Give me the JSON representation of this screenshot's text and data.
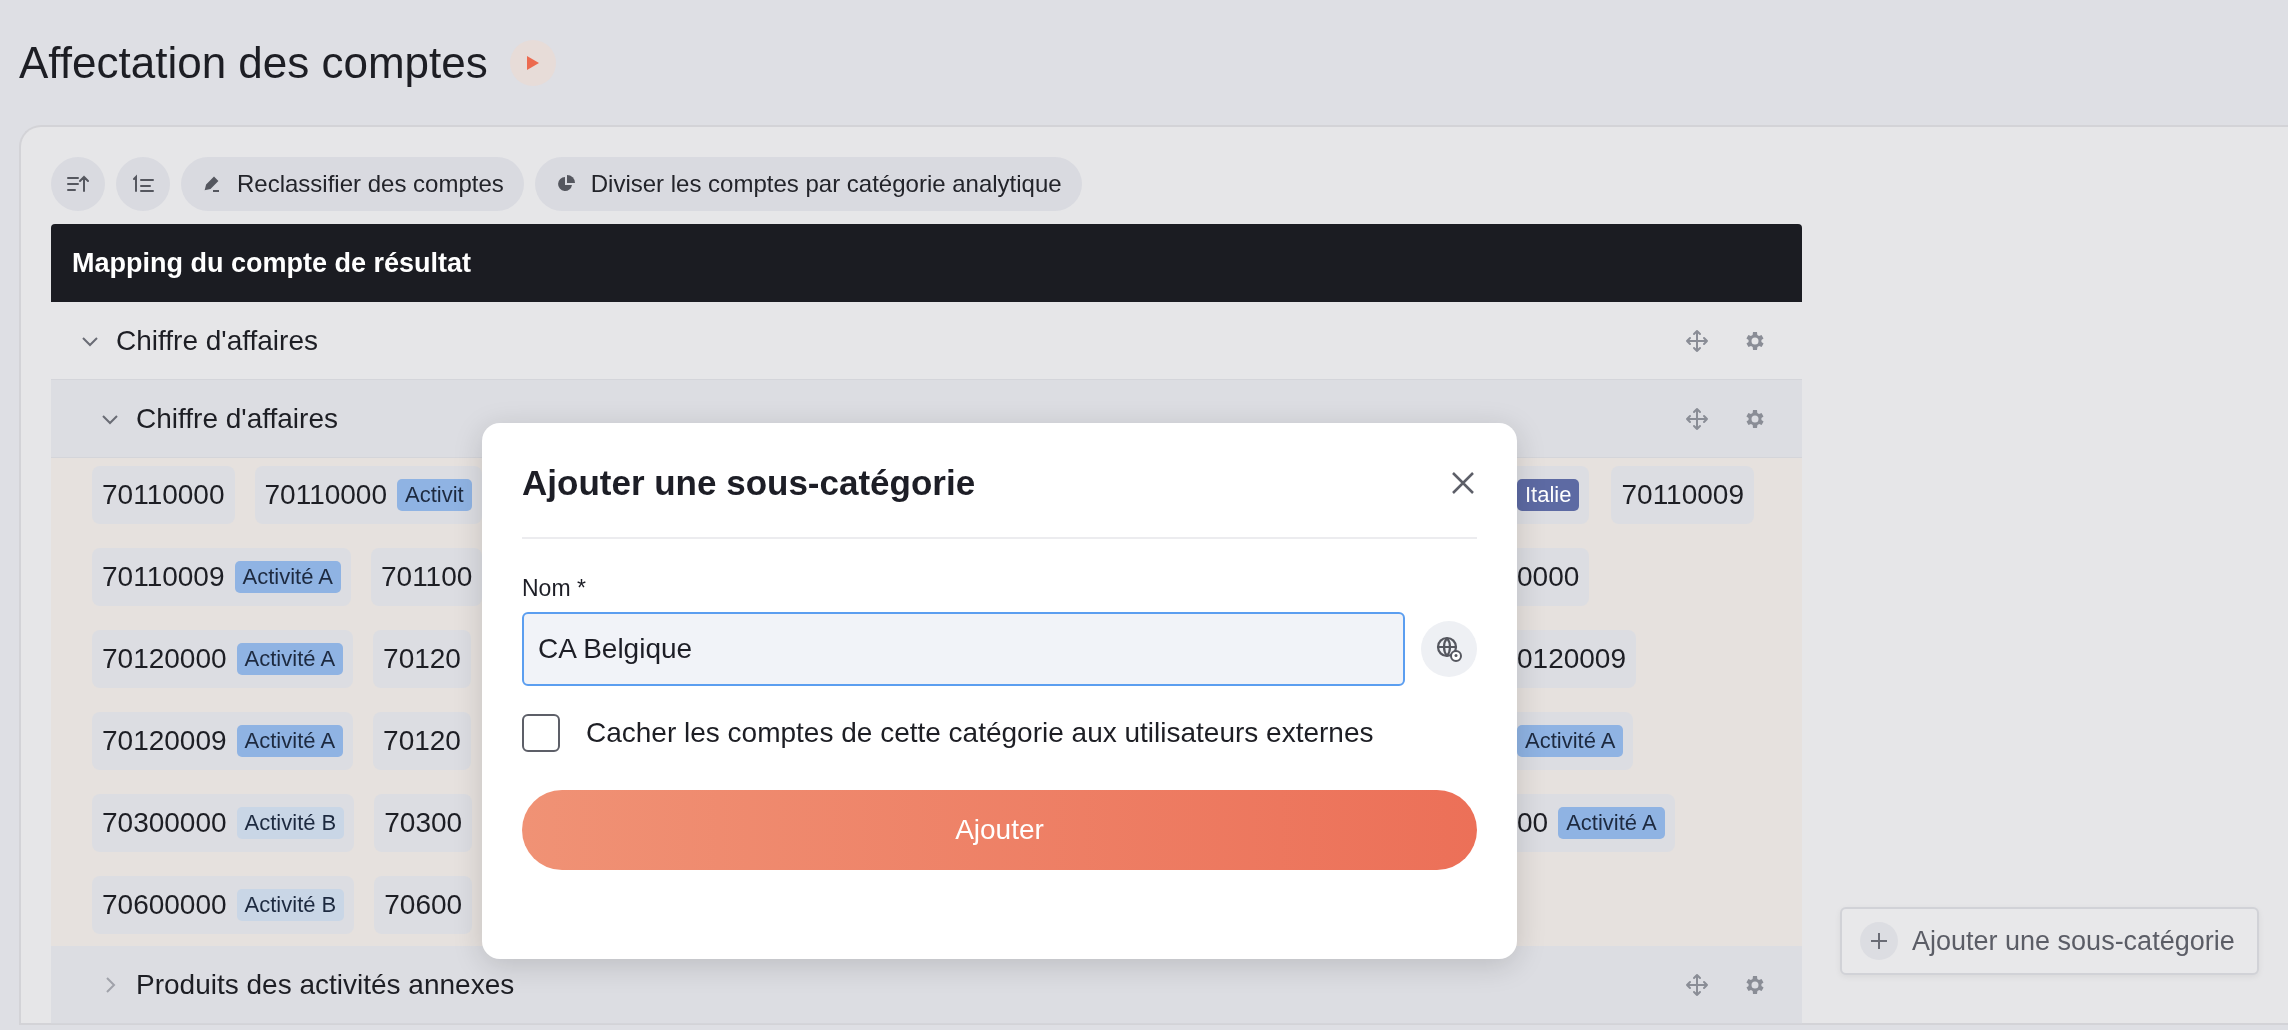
{
  "page": {
    "title": "Affectation des comptes"
  },
  "toolbar": {
    "buttons": [
      {
        "label": "Reclassifier des comptes"
      },
      {
        "label": "Diviser les comptes par catégorie analytique"
      }
    ]
  },
  "table": {
    "header": "Mapping du compte de résultat",
    "rows": [
      {
        "label": "Chiffre d'affaires",
        "expanded": true,
        "children": [
          {
            "label": "Chiffre d'affaires",
            "expanded": true,
            "account_rows": [
              {
                "left": [
                  {
                    "number": "70110000"
                  },
                  {
                    "number": "70110000",
                    "badge": {
                      "text": "Activit",
                      "color": "#8fb3e3"
                    }
                  }
                ],
                "right": [
                  {
                    "badge": {
                      "text": "Italie",
                      "color": "#5d6aa3"
                    }
                  },
                  {
                    "number": "70110009"
                  }
                ]
              },
              {
                "left": [
                  {
                    "number": "70110009",
                    "badge": {
                      "text": "Activité A",
                      "color": "#8fb3e3"
                    }
                  },
                  {
                    "number": "701100"
                  }
                ],
                "right": [
                  {
                    "number": "0000"
                  }
                ]
              },
              {
                "left": [
                  {
                    "number": "70120000",
                    "badge": {
                      "text": "Activité A",
                      "color": "#8fb3e3"
                    }
                  },
                  {
                    "number": "70120"
                  }
                ],
                "right": [
                  {
                    "number": "0120009"
                  }
                ]
              },
              {
                "left": [
                  {
                    "number": "70120009",
                    "badge": {
                      "text": "Activité A",
                      "color": "#8fb3e3"
                    }
                  },
                  {
                    "number": "70120"
                  }
                ],
                "right": [
                  {
                    "badge": {
                      "text": "Activité A",
                      "color": "#8fb3e3"
                    }
                  }
                ]
              },
              {
                "left": [
                  {
                    "number": "70300000",
                    "badge": {
                      "text": "Activité B",
                      "color": "#c9d6e6"
                    }
                  },
                  {
                    "number": "70300"
                  }
                ],
                "right": [
                  {
                    "number": "00",
                    "badge": {
                      "text": "Activité A",
                      "color": "#8fb3e3"
                    }
                  }
                ]
              },
              {
                "left": [
                  {
                    "number": "70600000",
                    "badge": {
                      "text": "Activité B",
                      "color": "#c9d6e6"
                    }
                  },
                  {
                    "number": "70600"
                  }
                ],
                "right": []
              }
            ]
          },
          {
            "label": "Produits des activités annexes",
            "expanded": false
          }
        ]
      }
    ]
  },
  "add_subcategory_button": "Ajouter une sous-catégorie",
  "dialog": {
    "title": "Ajouter une sous-catégorie",
    "field": {
      "label": "Nom *",
      "value": "CA Belgique"
    },
    "checkbox": {
      "label": "Cacher les comptes de cette catégorie aux utilisateurs externes",
      "checked": false
    },
    "submit": "Ajouter"
  }
}
